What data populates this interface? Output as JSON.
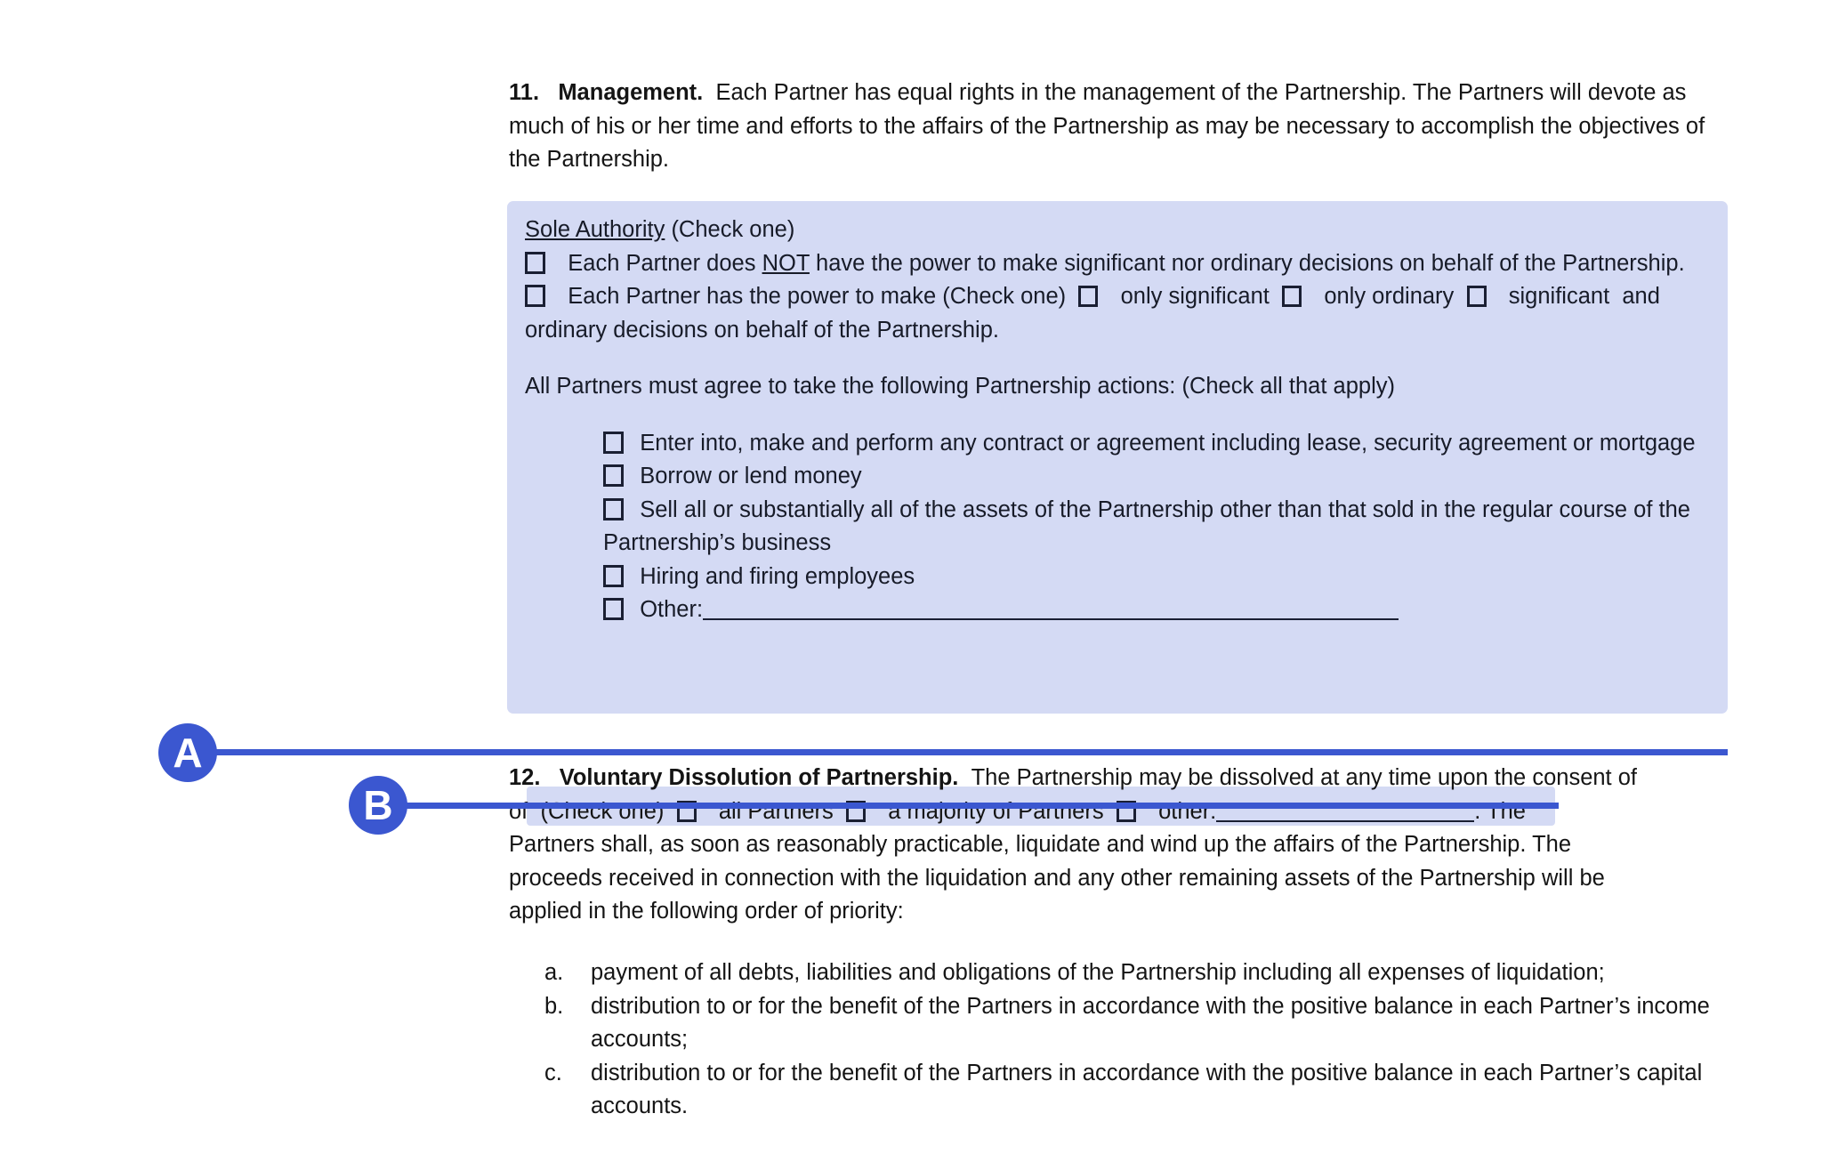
{
  "document": {
    "section11": {
      "number": "11.",
      "title": "Management.",
      "body": "Each Partner has equal rights in the management of the Partnership. The Partners will devote as much of his or her time and efforts to the affairs of the Partnership as may be necessary to accomplish the objectives of the Partnership."
    },
    "sole_authority": {
      "heading_underlined": "Sole Authority",
      "heading_suffix": " (Check one)",
      "option1_pre": "Each Partner does ",
      "option1_not": "NOT",
      "option1_post": " have the power to make significant nor ordinary decisions on behalf of the Partnership.",
      "option2_pre": "Each Partner has the power to make (Check one)",
      "option2_choice1": "only significant",
      "option2_choice2": "only ordinary",
      "option2_choice3": "significant",
      "option2_post": "and ordinary decisions on behalf of the Partnership.",
      "actions_intro": "All Partners must agree to take the following Partnership actions: (Check all that apply)",
      "actions": [
        "Enter into, make and perform any contract or agreement including lease, security agreement or mortgage",
        "Borrow or lend money",
        "Sell all or substantially all of the assets of the Partnership other than that sold in the regular course of the Partnership’s business",
        "Hiring and firing employees",
        "Other:"
      ]
    },
    "section12": {
      "number": "12.",
      "title": "Voluntary Dissolution of Partnership.",
      "lead": "The Partnership may be dissolved at any time upon the consent of",
      "check_one": "(Check one)",
      "choice1": "all Partners",
      "choice2": "a majority of Partners",
      "choice3": "other:",
      "after_blank": ". The",
      "body_line2": "Partners shall, as soon as reasonably practicable, liquidate and wind up the affairs of the Partnership. The",
      "body_line3": "proceeds received in connection with the liquidation and any other remaining assets of the Partnership will be",
      "body_line4": "applied in the following order of priority:",
      "items": [
        {
          "marker": "a.",
          "text": "payment of all debts, liabilities and obligations of the Partnership including all expenses of liquidation;"
        },
        {
          "marker": "b.",
          "text": "distribution to or for the benefit of the Partners in accordance with the positive balance in each Partner’s income accounts;"
        },
        {
          "marker": "c.",
          "text": "distribution to or for the benefit of the Partners in accordance with the positive balance in each Partner’s capital accounts."
        }
      ]
    }
  },
  "annotations": {
    "marker_a": "A",
    "marker_b": "B",
    "accent_color": "#3b57d0",
    "highlight_color": "#d4daf4"
  }
}
